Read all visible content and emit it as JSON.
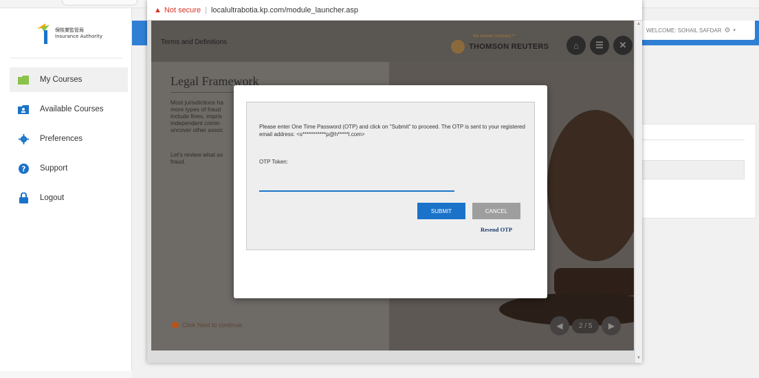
{
  "app": {
    "logo_text_line1": "保險業監管局",
    "logo_text_line2": "Insurance Authority",
    "welcome_text": "WELCOME: SOHAIL SAFDAR"
  },
  "sidebar": {
    "items": [
      {
        "label": "My Courses",
        "icon": "folder-icon",
        "color": "#8bc34a",
        "active": true
      },
      {
        "label": "Available Courses",
        "icon": "folder-person-icon",
        "color": "#1a73c8",
        "active": false
      },
      {
        "label": "Preferences",
        "icon": "gear-icon",
        "color": "#1a73c8",
        "active": false
      },
      {
        "label": "Support",
        "icon": "question-icon",
        "color": "#1a73c8",
        "active": false
      },
      {
        "label": "Logout",
        "icon": "lock-icon",
        "color": "#1a73c8",
        "active": false
      }
    ]
  },
  "browser": {
    "security_label": "Not secure",
    "url": "localultrabotia.kp.com/module_launcher.asp"
  },
  "course": {
    "module_title": "Terms and Definitions",
    "brand_tagline": "the answer company™",
    "brand_name": "THOMSON REUTERS",
    "slide_title": "Legal Framework",
    "body_lines": [
      "Most jurisdictions ha",
      "more types of fraud",
      "include fines, impris",
      "independent crimin",
      "uncover other assoc"
    ],
    "body2_lines": [
      "Let's review what so",
      "fraud."
    ],
    "click_next": "Click Next to continue.",
    "page_indicator": "2 / 5"
  },
  "otp_modal": {
    "message": "Please enter One Time Password (OTP) and click on \"Submit\" to proceed. The OTP is sent to your registered email address: <s***********p@h*****l.com>",
    "token_label": "OTP Token:",
    "token_value": "",
    "submit_label": "SUBMIT",
    "cancel_label": "CANCEL",
    "resend_label": "Resend OTP"
  },
  "colors": {
    "accent_blue": "#1a73c8",
    "header_blue": "#2f7fd4",
    "warning_red": "#d93025"
  }
}
